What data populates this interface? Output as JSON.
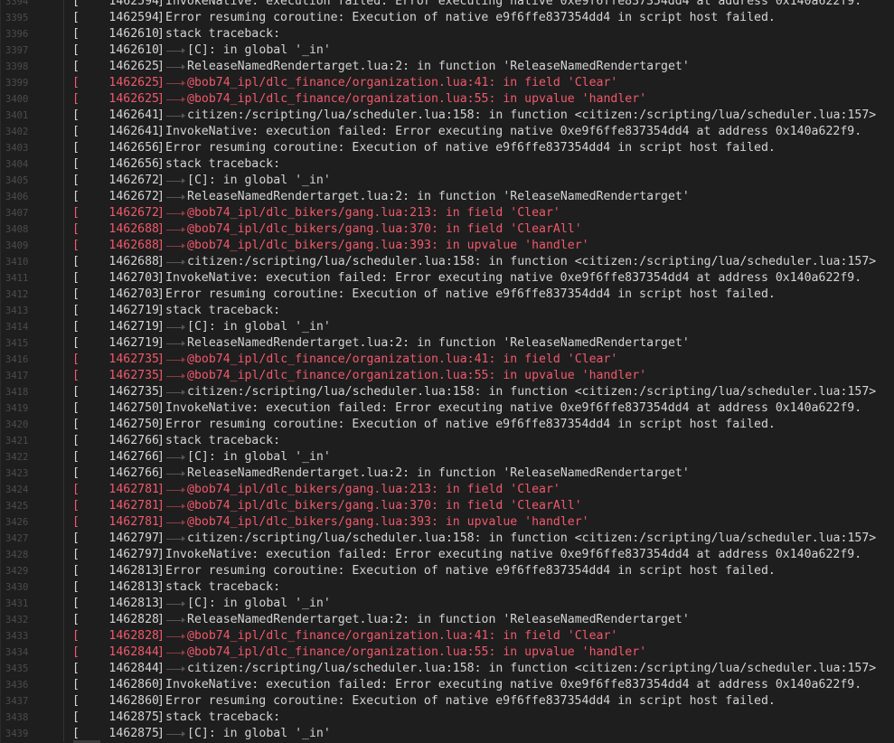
{
  "log": {
    "lines": [
      {
        "n": "3394",
        "ts": "1462594",
        "text": "InvokeNative: execution failed: Error executing native 0xe9f6ffe837354dd4 at address 0x140a622f9.",
        "indent": false,
        "red": false
      },
      {
        "n": "3395",
        "ts": "1462594",
        "text": "Error resuming coroutine: Execution of native e9f6ffe837354dd4 in script host failed.",
        "indent": false,
        "red": false
      },
      {
        "n": "3396",
        "ts": "1462610",
        "text": "stack traceback:",
        "indent": false,
        "red": false
      },
      {
        "n": "3397",
        "ts": "1462610",
        "text": "[C]: in global '_in'",
        "indent": true,
        "red": false
      },
      {
        "n": "3398",
        "ts": "1462625",
        "text": "ReleaseNamedRendertarget.lua:2: in function 'ReleaseNamedRendertarget'",
        "indent": true,
        "red": false
      },
      {
        "n": "3399",
        "ts": "1462625",
        "text": "@bob74_ipl/dlc_finance/organization.lua:41: in field 'Clear'",
        "indent": true,
        "red": true
      },
      {
        "n": "3400",
        "ts": "1462625",
        "text": "@bob74_ipl/dlc_finance/organization.lua:55: in upvalue 'handler'",
        "indent": true,
        "red": true
      },
      {
        "n": "3401",
        "ts": "1462641",
        "text": "citizen:/scripting/lua/scheduler.lua:158: in function <citizen:/scripting/lua/scheduler.lua:157>",
        "indent": true,
        "red": false
      },
      {
        "n": "3402",
        "ts": "1462641",
        "text": "InvokeNative: execution failed: Error executing native 0xe9f6ffe837354dd4 at address 0x140a622f9.",
        "indent": false,
        "red": false
      },
      {
        "n": "3403",
        "ts": "1462656",
        "text": "Error resuming coroutine: Execution of native e9f6ffe837354dd4 in script host failed.",
        "indent": false,
        "red": false
      },
      {
        "n": "3404",
        "ts": "1462656",
        "text": "stack traceback:",
        "indent": false,
        "red": false
      },
      {
        "n": "3405",
        "ts": "1462672",
        "text": "[C]: in global '_in'",
        "indent": true,
        "red": false
      },
      {
        "n": "3406",
        "ts": "1462672",
        "text": "ReleaseNamedRendertarget.lua:2: in function 'ReleaseNamedRendertarget'",
        "indent": true,
        "red": false
      },
      {
        "n": "3407",
        "ts": "1462672",
        "text": "@bob74_ipl/dlc_bikers/gang.lua:213: in field 'Clear'",
        "indent": true,
        "red": true
      },
      {
        "n": "3408",
        "ts": "1462688",
        "text": "@bob74_ipl/dlc_bikers/gang.lua:370: in field 'ClearAll'",
        "indent": true,
        "red": true
      },
      {
        "n": "3409",
        "ts": "1462688",
        "text": "@bob74_ipl/dlc_bikers/gang.lua:393: in upvalue 'handler'",
        "indent": true,
        "red": true
      },
      {
        "n": "3410",
        "ts": "1462688",
        "text": "citizen:/scripting/lua/scheduler.lua:158: in function <citizen:/scripting/lua/scheduler.lua:157>",
        "indent": true,
        "red": false
      },
      {
        "n": "3411",
        "ts": "1462703",
        "text": "InvokeNative: execution failed: Error executing native 0xe9f6ffe837354dd4 at address 0x140a622f9.",
        "indent": false,
        "red": false
      },
      {
        "n": "3412",
        "ts": "1462703",
        "text": "Error resuming coroutine: Execution of native e9f6ffe837354dd4 in script host failed.",
        "indent": false,
        "red": false
      },
      {
        "n": "3413",
        "ts": "1462719",
        "text": "stack traceback:",
        "indent": false,
        "red": false
      },
      {
        "n": "3414",
        "ts": "1462719",
        "text": "[C]: in global '_in'",
        "indent": true,
        "red": false
      },
      {
        "n": "3415",
        "ts": "1462719",
        "text": "ReleaseNamedRendertarget.lua:2: in function 'ReleaseNamedRendertarget'",
        "indent": true,
        "red": false
      },
      {
        "n": "3416",
        "ts": "1462735",
        "text": "@bob74_ipl/dlc_finance/organization.lua:41: in field 'Clear'",
        "indent": true,
        "red": true
      },
      {
        "n": "3417",
        "ts": "1462735",
        "text": "@bob74_ipl/dlc_finance/organization.lua:55: in upvalue 'handler'",
        "indent": true,
        "red": true
      },
      {
        "n": "3418",
        "ts": "1462735",
        "text": "citizen:/scripting/lua/scheduler.lua:158: in function <citizen:/scripting/lua/scheduler.lua:157>",
        "indent": true,
        "red": false
      },
      {
        "n": "3419",
        "ts": "1462750",
        "text": "InvokeNative: execution failed: Error executing native 0xe9f6ffe837354dd4 at address 0x140a622f9.",
        "indent": false,
        "red": false
      },
      {
        "n": "3420",
        "ts": "1462750",
        "text": "Error resuming coroutine: Execution of native e9f6ffe837354dd4 in script host failed.",
        "indent": false,
        "red": false
      },
      {
        "n": "3421",
        "ts": "1462766",
        "text": "stack traceback:",
        "indent": false,
        "red": false
      },
      {
        "n": "3422",
        "ts": "1462766",
        "text": "[C]: in global '_in'",
        "indent": true,
        "red": false
      },
      {
        "n": "3423",
        "ts": "1462766",
        "text": "ReleaseNamedRendertarget.lua:2: in function 'ReleaseNamedRendertarget'",
        "indent": true,
        "red": false
      },
      {
        "n": "3424",
        "ts": "1462781",
        "text": "@bob74_ipl/dlc_bikers/gang.lua:213: in field 'Clear'",
        "indent": true,
        "red": true
      },
      {
        "n": "3425",
        "ts": "1462781",
        "text": "@bob74_ipl/dlc_bikers/gang.lua:370: in field 'ClearAll'",
        "indent": true,
        "red": true
      },
      {
        "n": "3426",
        "ts": "1462781",
        "text": "@bob74_ipl/dlc_bikers/gang.lua:393: in upvalue 'handler'",
        "indent": true,
        "red": true
      },
      {
        "n": "3427",
        "ts": "1462797",
        "text": "citizen:/scripting/lua/scheduler.lua:158: in function <citizen:/scripting/lua/scheduler.lua:157>",
        "indent": true,
        "red": false
      },
      {
        "n": "3428",
        "ts": "1462797",
        "text": "InvokeNative: execution failed: Error executing native 0xe9f6ffe837354dd4 at address 0x140a622f9.",
        "indent": false,
        "red": false
      },
      {
        "n": "3429",
        "ts": "1462813",
        "text": "Error resuming coroutine: Execution of native e9f6ffe837354dd4 in script host failed.",
        "indent": false,
        "red": false
      },
      {
        "n": "3430",
        "ts": "1462813",
        "text": "stack traceback:",
        "indent": false,
        "red": false
      },
      {
        "n": "3431",
        "ts": "1462813",
        "text": "[C]: in global '_in'",
        "indent": true,
        "red": false
      },
      {
        "n": "3432",
        "ts": "1462828",
        "text": "ReleaseNamedRendertarget.lua:2: in function 'ReleaseNamedRendertarget'",
        "indent": true,
        "red": false
      },
      {
        "n": "3433",
        "ts": "1462828",
        "text": "@bob74_ipl/dlc_finance/organization.lua:41: in field 'Clear'",
        "indent": true,
        "red": true
      },
      {
        "n": "3434",
        "ts": "1462844",
        "text": "@bob74_ipl/dlc_finance/organization.lua:55: in upvalue 'handler'",
        "indent": true,
        "red": true
      },
      {
        "n": "3435",
        "ts": "1462844",
        "text": "citizen:/scripting/lua/scheduler.lua:158: in function <citizen:/scripting/lua/scheduler.lua:157>",
        "indent": true,
        "red": false
      },
      {
        "n": "3436",
        "ts": "1462860",
        "text": "InvokeNative: execution failed: Error executing native 0xe9f6ffe837354dd4 at address 0x140a622f9.",
        "indent": false,
        "red": false
      },
      {
        "n": "3437",
        "ts": "1462860",
        "text": "Error resuming coroutine: Execution of native e9f6ffe837354dd4 in script host failed.",
        "indent": false,
        "red": false
      },
      {
        "n": "3438",
        "ts": "1462875",
        "text": "stack traceback:",
        "indent": false,
        "red": false
      },
      {
        "n": "3439",
        "ts": "1462875",
        "text": "[C]: in global '_in'",
        "indent": true,
        "red": false
      }
    ]
  },
  "colors": {
    "background": "#1e1e1e",
    "text": "#d4d4d4",
    "error_red": "#f0596b",
    "line_number": "#4c4c4c"
  }
}
